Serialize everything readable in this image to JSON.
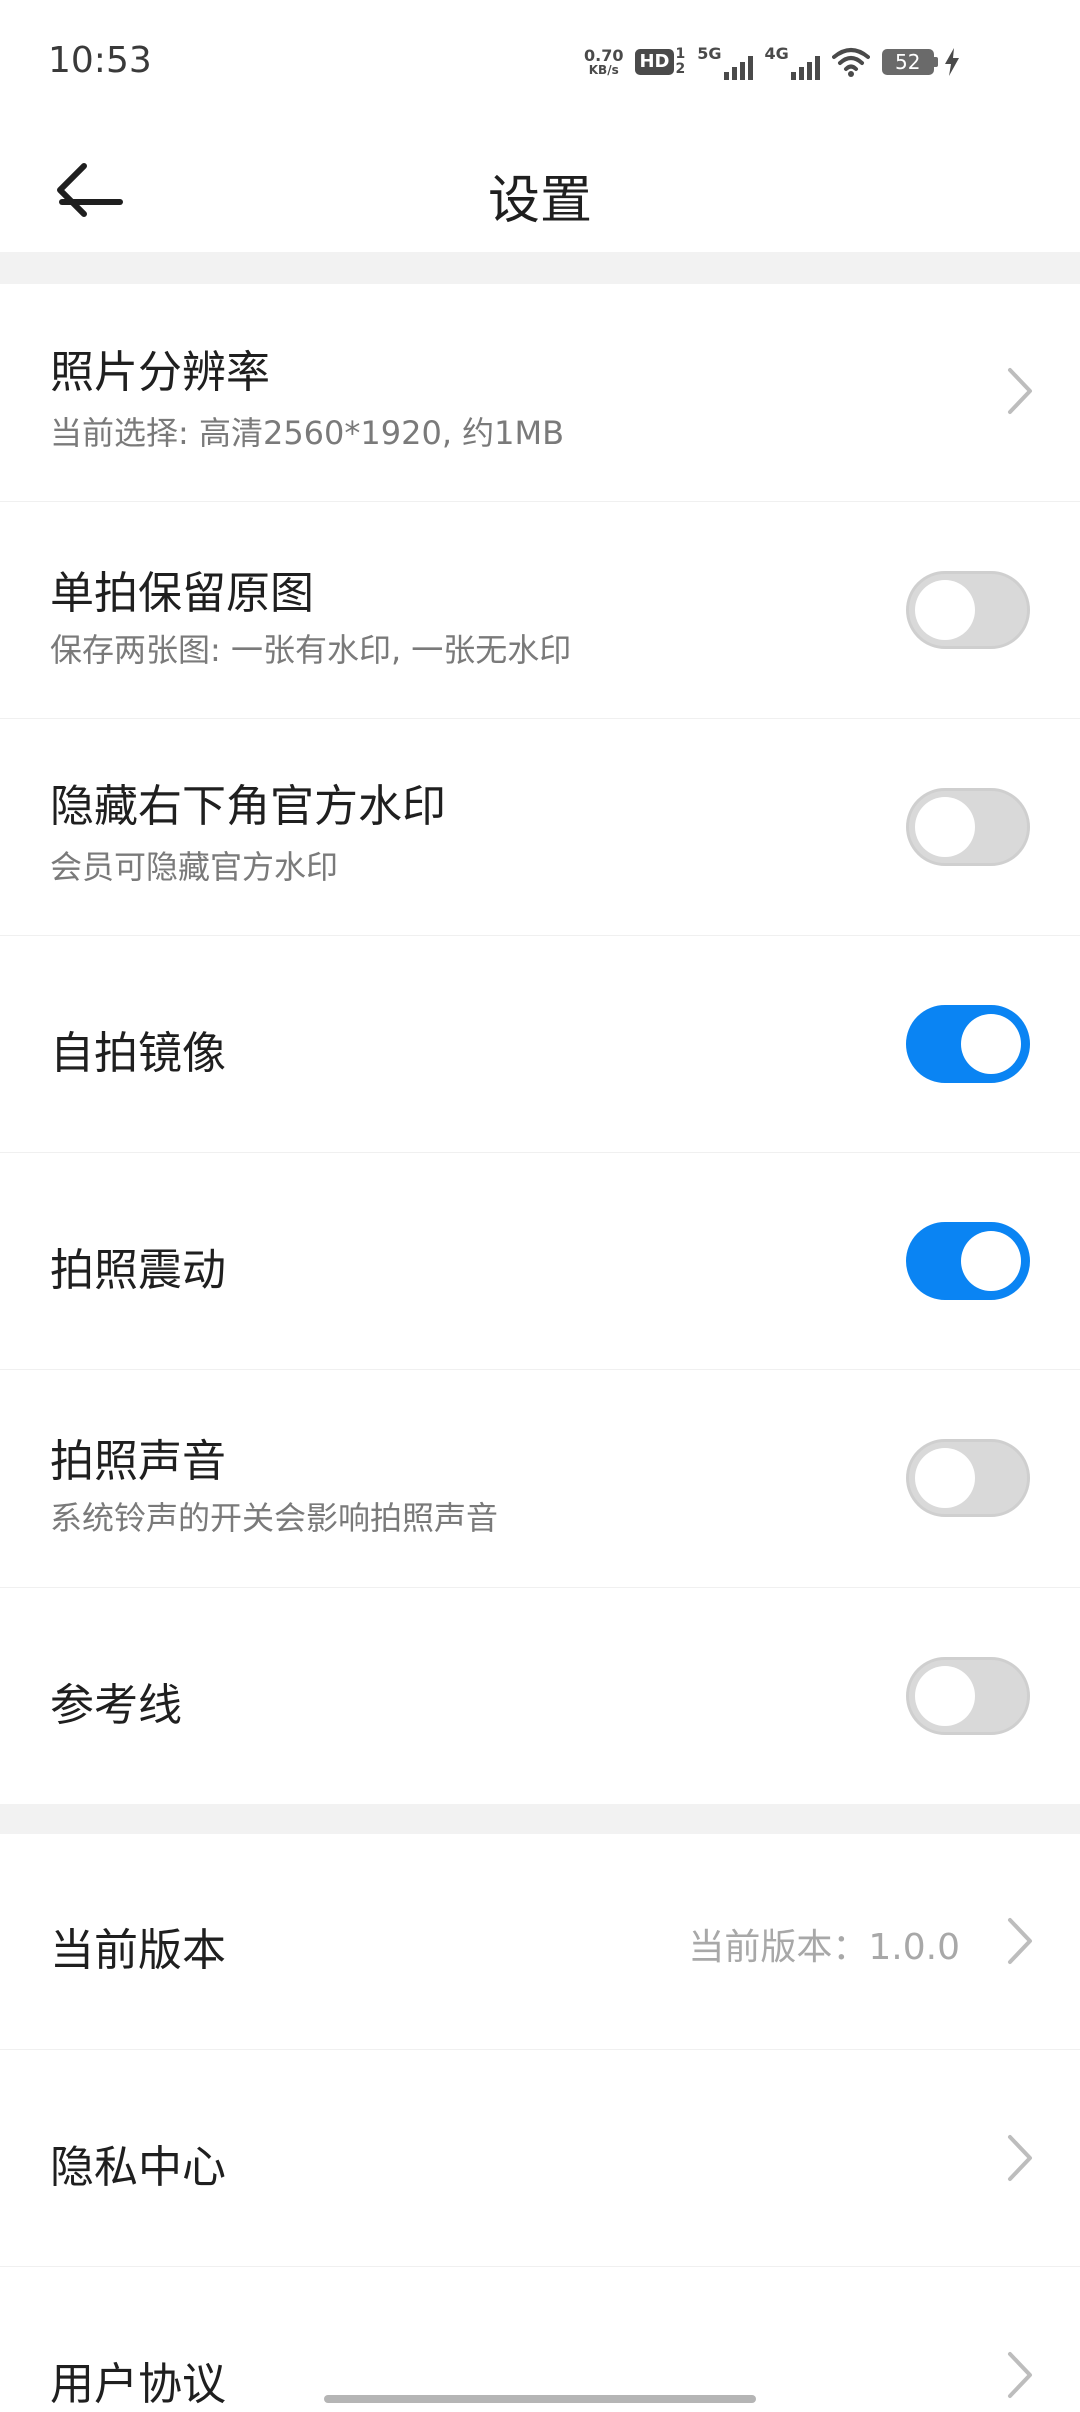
{
  "status_bar": {
    "time": "10:53",
    "net_speed_value": "0.70",
    "net_speed_unit": "KB/s",
    "hd_label": "HD",
    "hd_sim_top": "1",
    "hd_sim_bottom": "2",
    "signal_5g": "5G",
    "signal_4g": "4G",
    "battery_level": "52",
    "icons": [
      "wifi-icon",
      "charging-icon"
    ]
  },
  "header": {
    "title": "设置",
    "back_icon": "back-arrow-icon"
  },
  "settings": {
    "photo_resolution": {
      "title": "照片分辨率",
      "subtitle": "当前选择: 高清2560*1920, 约1MB"
    },
    "keep_original": {
      "title": "单拍保留原图",
      "subtitle": "保存两张图: 一张有水印, 一张无水印",
      "on": false
    },
    "hide_watermark": {
      "title": "隐藏右下角官方水印",
      "subtitle": "会员可隐藏官方水印",
      "on": false
    },
    "selfie_mirror": {
      "title": "自拍镜像",
      "on": true
    },
    "shutter_vibration": {
      "title": "拍照震动",
      "on": true
    },
    "shutter_sound": {
      "title": "拍照声音",
      "subtitle": "系统铃声的开关会影响拍照声音",
      "on": false
    },
    "grid_lines": {
      "title": "参考线",
      "on": false
    }
  },
  "about": {
    "version": {
      "title": "当前版本",
      "value": "当前版本：1.0.0"
    },
    "privacy": {
      "title": "隐私中心"
    },
    "agreement": {
      "title": "用户协议"
    }
  },
  "colors": {
    "accent": "#0a84f3",
    "toggle_off": "#d9d9d9",
    "section_gap": "#f2f2f2"
  }
}
